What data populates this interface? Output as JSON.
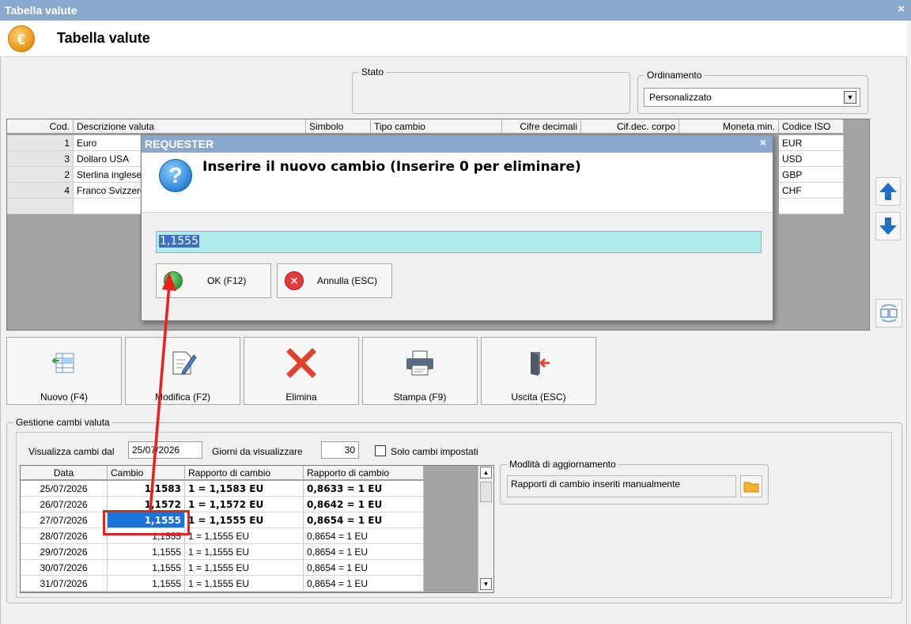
{
  "window": {
    "title": "Tabella valute",
    "close_glyph": "×",
    "header_title": "Tabella valute",
    "icon": "euro-icon",
    "euro_glyph": "€"
  },
  "stato": {
    "legend": "Stato"
  },
  "ordinamento": {
    "legend": "Ordinamento",
    "selected": "Personalizzato"
  },
  "grid": {
    "columns": [
      "Cod.",
      "Descrizione valuta",
      "Simbolo",
      "Tipo cambio",
      "Cifre decimali",
      "Cif.dec. corpo",
      "Moneta min.",
      "Codice ISO"
    ],
    "rows": [
      {
        "cod": "1",
        "descr": "Euro",
        "iso": "EUR"
      },
      {
        "cod": "3",
        "descr": "Dollaro USA",
        "iso": "USD"
      },
      {
        "cod": "2",
        "descr": "Sterlina inglese",
        "iso": "GBP"
      },
      {
        "cod": "4",
        "descr": "Franco Svizzero",
        "iso": "CHF"
      }
    ]
  },
  "toolbar": {
    "nuovo": "Nuovo (F4)",
    "modifica": "Modifica (F2)",
    "elimina": "Elimina",
    "stampa": "Stampa (F9)",
    "uscita": "Uscita (ESC)"
  },
  "gestione": {
    "legend": "Gestione cambi valuta",
    "visualizza_label": "Visualizza cambi dal",
    "date_from": "25/07/2026",
    "giorni_label": "Giorni da visualizzare",
    "giorni_value": "30",
    "solo_label": "Solo cambi impostati",
    "columns": [
      "Data",
      "Cambio",
      "Rapporto di cambio",
      "Rapporto di cambio"
    ],
    "rows": [
      {
        "data": "25/07/2026",
        "cambio": "1,1583",
        "r1": "1  = 1,1583 EU",
        "r2": "0,8633  = 1 EU",
        "bold": true
      },
      {
        "data": "26/07/2026",
        "cambio": "1,1572",
        "r1": "1  = 1,1572 EU",
        "r2": "0,8642  = 1 EU",
        "bold": true
      },
      {
        "data": "27/07/2026",
        "cambio": "1,1555",
        "r1": "1  = 1,1555 EU",
        "r2": "0,8654  = 1 EU",
        "bold": true,
        "selected": true
      },
      {
        "data": "28/07/2026",
        "cambio": "1,1555",
        "r1": "1  = 1,1555 EU",
        "r2": "0,8654  = 1 EU",
        "bold": false
      },
      {
        "data": "29/07/2026",
        "cambio": "1,1555",
        "r1": "1  = 1,1555 EU",
        "r2": "0,8654  = 1 EU",
        "bold": false
      },
      {
        "data": "30/07/2026",
        "cambio": "1,1555",
        "r1": "1  = 1,1555 EU",
        "r2": "0,8654  = 1 EU",
        "bold": false
      },
      {
        "data": "31/07/2026",
        "cambio": "1,1555",
        "r1": "1  = 1,1555 EU",
        "r2": "0,8654  = 1 EU",
        "bold": false
      }
    ],
    "modalita_legend": "Modlità di aggiornamento",
    "modalita_value": "Rapporti di cambio inseriti manualmente"
  },
  "modal": {
    "title": "REQUESTER",
    "close_glyph": "×",
    "question_glyph": "?",
    "prompt": "Inserire il nuovo cambio (Inserire 0 per eliminare)",
    "value": "1,1555",
    "ok_label": "OK (F12)",
    "cancel_label": "Annulla (ESC)"
  },
  "colors": {
    "titlebar": "#8aa8cc",
    "selection": "#1a73d8",
    "annotation": "#e8221b",
    "modal_input": "#b0ecec"
  }
}
